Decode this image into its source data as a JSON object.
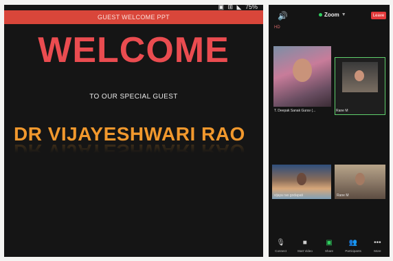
{
  "presentation": {
    "status": [
      "▣",
      "⊞",
      "◣",
      "75%"
    ],
    "header_title": "GUEST WELCOME PPT",
    "heading": "WELCOME",
    "subheading": "TO OUR SPECIAL GUEST",
    "guest_name": "DR VIJAYESHWARI RAO",
    "colors": {
      "header": "#d9463a",
      "heading": "#ea4c50",
      "guest": "#f1982d"
    }
  },
  "zoom": {
    "title": "Zoom",
    "leave_label": "Leave",
    "hd_label": "HD",
    "participants": [
      {
        "name": "T. Deepak Sanak Gurav (..."
      },
      {
        "name": "Rane M"
      },
      {
        "name": "vijaya rao godapati"
      },
      {
        "name": "Rane M"
      }
    ],
    "toolbar": [
      {
        "icon": "microphone-icon",
        "label": "Connect"
      },
      {
        "icon": "video-icon",
        "label": "Start Video"
      },
      {
        "icon": "share-icon",
        "label": "Share"
      },
      {
        "icon": "participants-icon",
        "label": "Participants"
      },
      {
        "icon": "more-icon",
        "label": "More"
      }
    ]
  }
}
